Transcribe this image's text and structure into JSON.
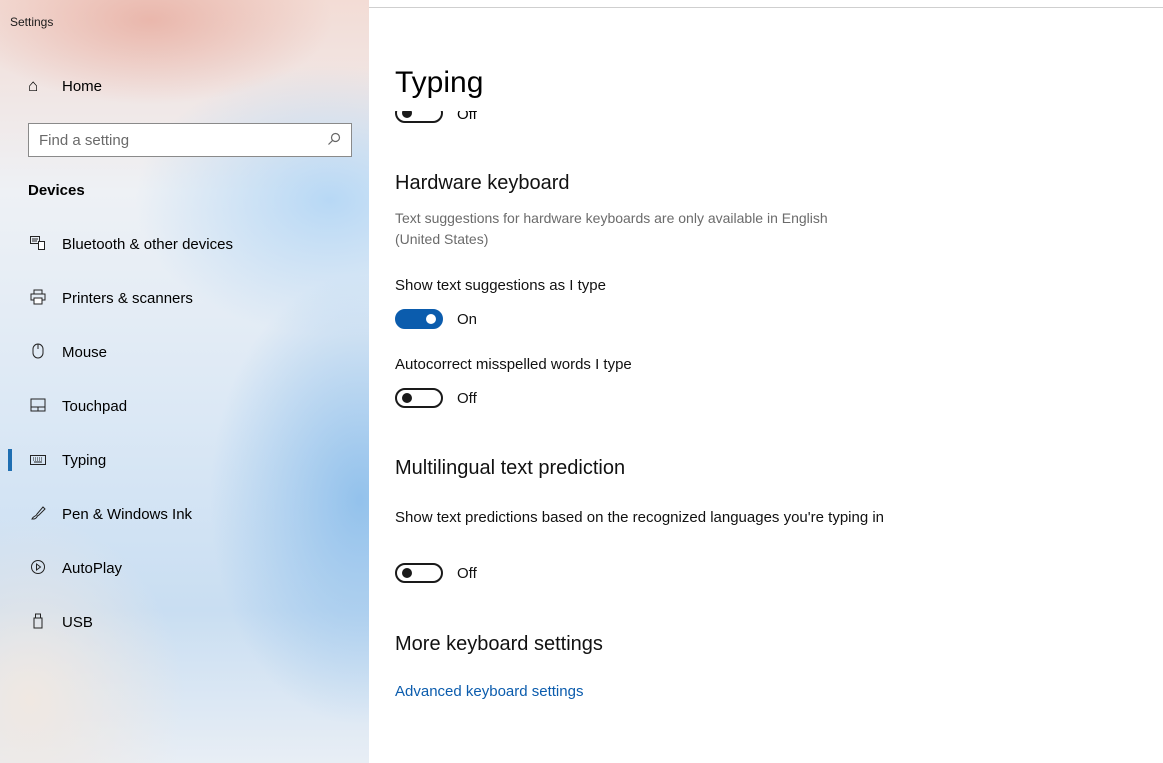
{
  "window": {
    "title": "Settings"
  },
  "sidebar": {
    "home_label": "Home",
    "search": {
      "placeholder": "Find a setting"
    },
    "section": "Devices",
    "items": [
      {
        "label": "Bluetooth & other devices",
        "icon": "bluetooth-devices-icon"
      },
      {
        "label": "Printers & scanners",
        "icon": "printer-icon"
      },
      {
        "label": "Mouse",
        "icon": "mouse-icon"
      },
      {
        "label": "Touchpad",
        "icon": "touchpad-icon"
      },
      {
        "label": "Typing",
        "icon": "keyboard-icon",
        "active": true
      },
      {
        "label": "Pen & Windows Ink",
        "icon": "pen-icon"
      },
      {
        "label": "AutoPlay",
        "icon": "autoplay-icon"
      },
      {
        "label": "USB",
        "icon": "usb-icon"
      }
    ]
  },
  "main": {
    "title": "Typing",
    "clipped_toggle_state": "Off",
    "hardware_keyboard": {
      "heading": "Hardware keyboard",
      "description": "Text suggestions for hardware keyboards are only available in English (United States)",
      "suggestions_label": "Show text suggestions as I type",
      "suggestions_state": "On",
      "autocorrect_label": "Autocorrect misspelled words I type",
      "autocorrect_state": "Off"
    },
    "multilingual": {
      "heading": "Multilingual text prediction",
      "label": "Show text predictions based on the recognized languages you're typing in",
      "state": "Off"
    },
    "more": {
      "heading": "More keyboard settings",
      "link": "Advanced keyboard settings"
    }
  },
  "colors": {
    "accent": "#0b5cad",
    "active_indicator": "#1f6fb2"
  }
}
